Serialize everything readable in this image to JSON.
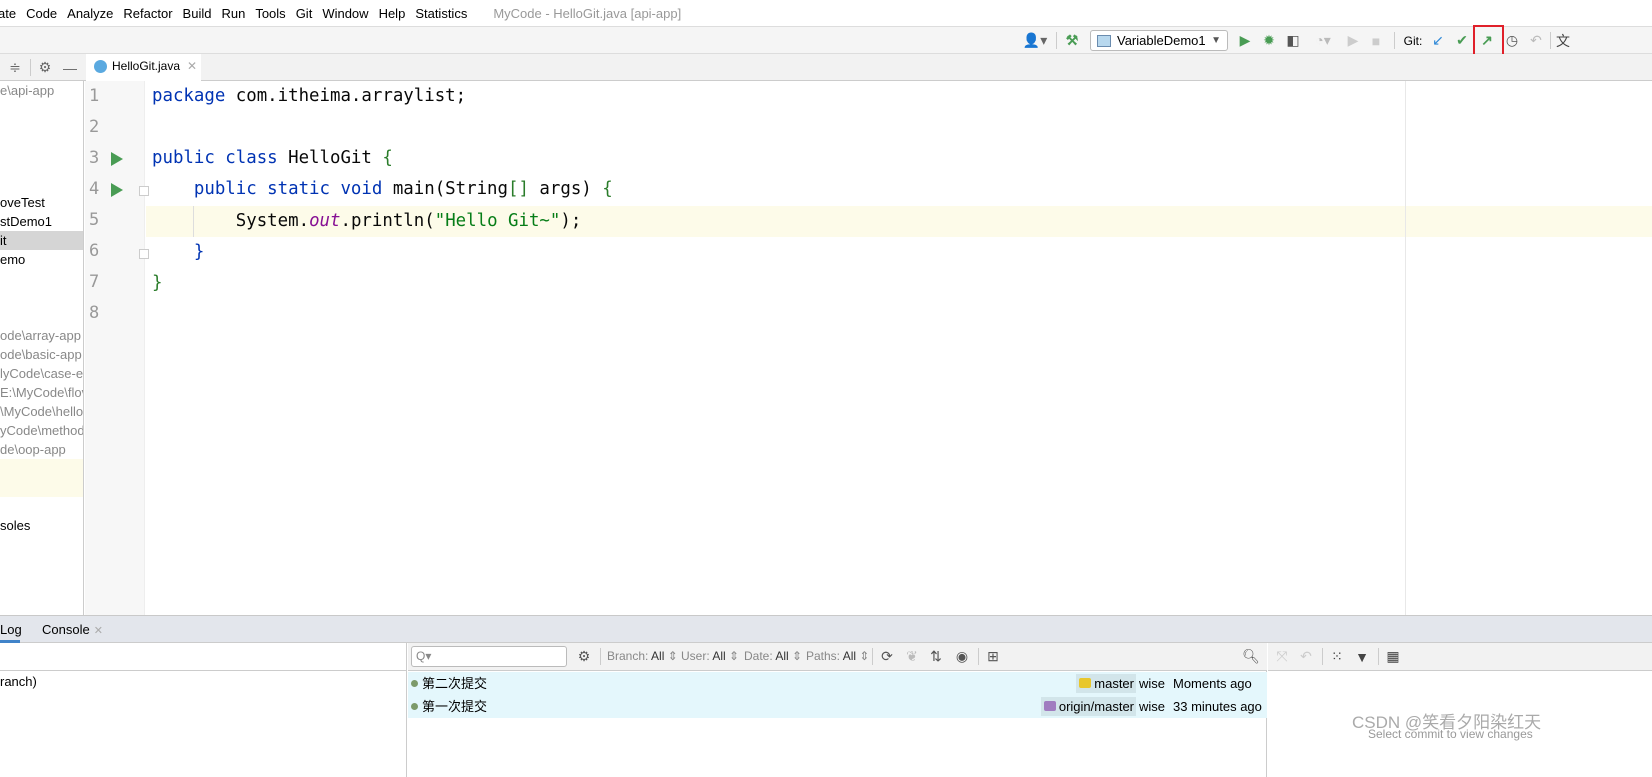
{
  "menu": [
    "ate",
    "Code",
    "Analyze",
    "Refactor",
    "Build",
    "Run",
    "Tools",
    "Git",
    "Window",
    "Help",
    "Statistics"
  ],
  "window_title": "MyCode - HelloGit.java [api-app]",
  "toolbar": {
    "run_config": "VariableDemo1",
    "git_label": "Git:",
    "highlight_color": "#e0202a",
    "icons": [
      "user-icon",
      "build-hammer-icon",
      "run-icon",
      "debug-icon",
      "coverage-icon",
      "profile-icon",
      "stop-icon",
      "git-update-icon",
      "git-commit-icon",
      "git-push-icon",
      "git-history-icon",
      "git-rollback-icon",
      "translate-icon"
    ]
  },
  "editor_tab": {
    "label": "HelloGit.java"
  },
  "project_items": [
    {
      "text": "e\\api-app",
      "gray": true
    },
    {
      "text": "oveTest",
      "gray": false
    },
    {
      "text": "stDemo1",
      "gray": false
    },
    {
      "text": "it",
      "gray": false,
      "selected": true
    },
    {
      "text": "emo",
      "gray": false
    },
    {
      "text": "ode\\array-app",
      "gray": true
    },
    {
      "text": "ode\\basic-app",
      "gray": true
    },
    {
      "text": "lyCode\\case-ex",
      "gray": true
    },
    {
      "text": "E:\\MyCode\\flov",
      "gray": true
    },
    {
      "text": "\\MyCode\\hello",
      "gray": true
    },
    {
      "text": "yCode\\method-",
      "gray": true
    },
    {
      "text": "de\\oop-app",
      "gray": true
    },
    {
      "text": "soles",
      "gray": false
    }
  ],
  "line_numbers": [
    "1",
    "2",
    "3",
    "4",
    "5",
    "6",
    "7",
    "8"
  ],
  "code": {
    "l1a": "package",
    "l1b": " com.itheima.arraylist;",
    "l3a": "public class",
    "l3b": " HelloGit ",
    "l3c": "{",
    "l4a": "    public static void",
    "l4b": " main(String",
    "l4c": "[]",
    "l4d": " args) ",
    "l4e": "{",
    "l5a": "        System.",
    "l5b": "out",
    "l5c": ".println(",
    "l5d": "\"Hello Git~\"",
    "l5e": ");",
    "l6": "    }",
    "l7": "}"
  },
  "bottom_tabs": {
    "log": "Log",
    "console": "Console"
  },
  "log_left_item": "ranch)",
  "log_filters": {
    "branch_label": "Branch:",
    "branch": "All",
    "user_label": "User:",
    "user": "All",
    "date_label": "Date:",
    "date": "All",
    "paths_label": "Paths:",
    "paths": "All"
  },
  "search_placeholder": "Q▾",
  "commits": [
    {
      "message": "第二次提交",
      "ref": "master",
      "ref_color": "#e8c72c",
      "author": "wise",
      "time": "Moments ago"
    },
    {
      "message": "第一次提交",
      "ref": "origin/master",
      "ref_color": "#a07cc0",
      "author": "wise",
      "time": "33 minutes ago"
    }
  ],
  "right_hint": "Select commit to view changes",
  "watermark": "CSDN @笑看夕阳染红天"
}
